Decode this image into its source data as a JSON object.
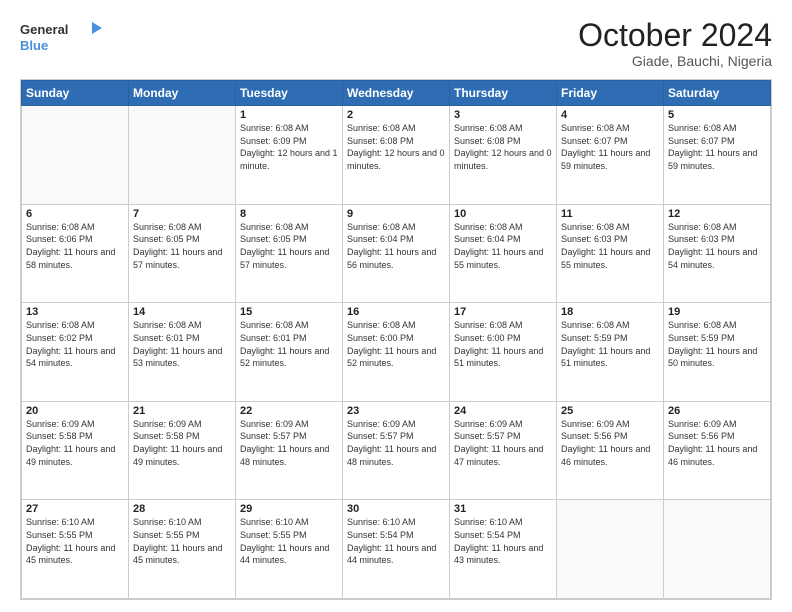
{
  "header": {
    "logo_line1": "General",
    "logo_line2": "Blue",
    "month_title": "October 2024",
    "location": "Giade, Bauchi, Nigeria"
  },
  "weekdays": [
    "Sunday",
    "Monday",
    "Tuesday",
    "Wednesday",
    "Thursday",
    "Friday",
    "Saturday"
  ],
  "weeks": [
    [
      {
        "day": "",
        "info": ""
      },
      {
        "day": "",
        "info": ""
      },
      {
        "day": "1",
        "sunrise": "Sunrise: 6:08 AM",
        "sunset": "Sunset: 6:09 PM",
        "daylight": "Daylight: 12 hours and 1 minute."
      },
      {
        "day": "2",
        "sunrise": "Sunrise: 6:08 AM",
        "sunset": "Sunset: 6:08 PM",
        "daylight": "Daylight: 12 hours and 0 minutes."
      },
      {
        "day": "3",
        "sunrise": "Sunrise: 6:08 AM",
        "sunset": "Sunset: 6:08 PM",
        "daylight": "Daylight: 12 hours and 0 minutes."
      },
      {
        "day": "4",
        "sunrise": "Sunrise: 6:08 AM",
        "sunset": "Sunset: 6:07 PM",
        "daylight": "Daylight: 11 hours and 59 minutes."
      },
      {
        "day": "5",
        "sunrise": "Sunrise: 6:08 AM",
        "sunset": "Sunset: 6:07 PM",
        "daylight": "Daylight: 11 hours and 59 minutes."
      }
    ],
    [
      {
        "day": "6",
        "sunrise": "Sunrise: 6:08 AM",
        "sunset": "Sunset: 6:06 PM",
        "daylight": "Daylight: 11 hours and 58 minutes."
      },
      {
        "day": "7",
        "sunrise": "Sunrise: 6:08 AM",
        "sunset": "Sunset: 6:05 PM",
        "daylight": "Daylight: 11 hours and 57 minutes."
      },
      {
        "day": "8",
        "sunrise": "Sunrise: 6:08 AM",
        "sunset": "Sunset: 6:05 PM",
        "daylight": "Daylight: 11 hours and 57 minutes."
      },
      {
        "day": "9",
        "sunrise": "Sunrise: 6:08 AM",
        "sunset": "Sunset: 6:04 PM",
        "daylight": "Daylight: 11 hours and 56 minutes."
      },
      {
        "day": "10",
        "sunrise": "Sunrise: 6:08 AM",
        "sunset": "Sunset: 6:04 PM",
        "daylight": "Daylight: 11 hours and 55 minutes."
      },
      {
        "day": "11",
        "sunrise": "Sunrise: 6:08 AM",
        "sunset": "Sunset: 6:03 PM",
        "daylight": "Daylight: 11 hours and 55 minutes."
      },
      {
        "day": "12",
        "sunrise": "Sunrise: 6:08 AM",
        "sunset": "Sunset: 6:03 PM",
        "daylight": "Daylight: 11 hours and 54 minutes."
      }
    ],
    [
      {
        "day": "13",
        "sunrise": "Sunrise: 6:08 AM",
        "sunset": "Sunset: 6:02 PM",
        "daylight": "Daylight: 11 hours and 54 minutes."
      },
      {
        "day": "14",
        "sunrise": "Sunrise: 6:08 AM",
        "sunset": "Sunset: 6:01 PM",
        "daylight": "Daylight: 11 hours and 53 minutes."
      },
      {
        "day": "15",
        "sunrise": "Sunrise: 6:08 AM",
        "sunset": "Sunset: 6:01 PM",
        "daylight": "Daylight: 11 hours and 52 minutes."
      },
      {
        "day": "16",
        "sunrise": "Sunrise: 6:08 AM",
        "sunset": "Sunset: 6:00 PM",
        "daylight": "Daylight: 11 hours and 52 minutes."
      },
      {
        "day": "17",
        "sunrise": "Sunrise: 6:08 AM",
        "sunset": "Sunset: 6:00 PM",
        "daylight": "Daylight: 11 hours and 51 minutes."
      },
      {
        "day": "18",
        "sunrise": "Sunrise: 6:08 AM",
        "sunset": "Sunset: 5:59 PM",
        "daylight": "Daylight: 11 hours and 51 minutes."
      },
      {
        "day": "19",
        "sunrise": "Sunrise: 6:08 AM",
        "sunset": "Sunset: 5:59 PM",
        "daylight": "Daylight: 11 hours and 50 minutes."
      }
    ],
    [
      {
        "day": "20",
        "sunrise": "Sunrise: 6:09 AM",
        "sunset": "Sunset: 5:58 PM",
        "daylight": "Daylight: 11 hours and 49 minutes."
      },
      {
        "day": "21",
        "sunrise": "Sunrise: 6:09 AM",
        "sunset": "Sunset: 5:58 PM",
        "daylight": "Daylight: 11 hours and 49 minutes."
      },
      {
        "day": "22",
        "sunrise": "Sunrise: 6:09 AM",
        "sunset": "Sunset: 5:57 PM",
        "daylight": "Daylight: 11 hours and 48 minutes."
      },
      {
        "day": "23",
        "sunrise": "Sunrise: 6:09 AM",
        "sunset": "Sunset: 5:57 PM",
        "daylight": "Daylight: 11 hours and 48 minutes."
      },
      {
        "day": "24",
        "sunrise": "Sunrise: 6:09 AM",
        "sunset": "Sunset: 5:57 PM",
        "daylight": "Daylight: 11 hours and 47 minutes."
      },
      {
        "day": "25",
        "sunrise": "Sunrise: 6:09 AM",
        "sunset": "Sunset: 5:56 PM",
        "daylight": "Daylight: 11 hours and 46 minutes."
      },
      {
        "day": "26",
        "sunrise": "Sunrise: 6:09 AM",
        "sunset": "Sunset: 5:56 PM",
        "daylight": "Daylight: 11 hours and 46 minutes."
      }
    ],
    [
      {
        "day": "27",
        "sunrise": "Sunrise: 6:10 AM",
        "sunset": "Sunset: 5:55 PM",
        "daylight": "Daylight: 11 hours and 45 minutes."
      },
      {
        "day": "28",
        "sunrise": "Sunrise: 6:10 AM",
        "sunset": "Sunset: 5:55 PM",
        "daylight": "Daylight: 11 hours and 45 minutes."
      },
      {
        "day": "29",
        "sunrise": "Sunrise: 6:10 AM",
        "sunset": "Sunset: 5:55 PM",
        "daylight": "Daylight: 11 hours and 44 minutes."
      },
      {
        "day": "30",
        "sunrise": "Sunrise: 6:10 AM",
        "sunset": "Sunset: 5:54 PM",
        "daylight": "Daylight: 11 hours and 44 minutes."
      },
      {
        "day": "31",
        "sunrise": "Sunrise: 6:10 AM",
        "sunset": "Sunset: 5:54 PM",
        "daylight": "Daylight: 11 hours and 43 minutes."
      },
      {
        "day": "",
        "info": ""
      },
      {
        "day": "",
        "info": ""
      }
    ]
  ]
}
